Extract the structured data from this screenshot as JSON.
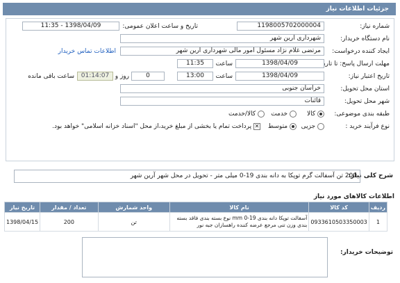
{
  "header": {
    "title": "جزئیات اطلاعات نیاز"
  },
  "fields": {
    "need_number_label": "شماره نیاز:",
    "need_number": "1198005702000004",
    "announce_label": "تاریخ و ساعت اعلان عمومی:",
    "announce_value": "1398/04/09 - 11:35",
    "buyer_org_label": "نام دستگاه خریدار:",
    "buyer_org": "شهرداری آرین شهر",
    "creator_label": "ایجاد کننده درخواست:",
    "creator": "مرتضی غلام نژاد مسئول امور مالی شهرداری آرین شهر",
    "contact_link": "اطلاعات تماس خریدار",
    "reply_deadline_label": "مهلت ارسال پاسخ: تا تاریخ:",
    "reply_date": "1398/04/09",
    "reply_time_label": "ساعت",
    "reply_time": "11:35",
    "validity_label": "تاریخ اعتبار نیاز:",
    "validity_date": "1398/04/09",
    "validity_time_label": "ساعت",
    "validity_time": "13:00",
    "days_value": "0",
    "days_label": "روز و",
    "remaining_value": "01:14:07",
    "remaining_label": "ساعت باقی مانده",
    "province_label": "استان محل تحویل:",
    "province": "خراسان جنوبی",
    "city_label": "شهر محل تحویل:",
    "city": "قائنات",
    "category_label": "طبقه بندی موضوعی:",
    "category_options": [
      "کالا",
      "خدمت",
      "کالا/خدمت"
    ],
    "process_label": "نوع فرآیند خرید :",
    "process_options": [
      "جزیی",
      "متوسط"
    ],
    "payment_note": "پرداخت تمام یا بخشی از مبلغ خرید،از محل \"اسناد خزانه اسلامی\" خواهد بود."
  },
  "description": {
    "label": "شرح کلی نیاز:",
    "value": "200 تن آسفالت گرم توپکا به دانه بندی 19-0 میلی متر - تحویل در محل شهر آرین شهر"
  },
  "items": {
    "title": "اطلاعات کالاهای مورد نیاز",
    "headers": [
      "ردیف",
      "کد کالا",
      "نام کالا",
      "واحد شمارش",
      "تعداد / مقدار",
      "تاریخ نیاز"
    ],
    "rows": [
      [
        "1",
        "0933610503350003",
        "آسفالت توپکا دانه بندی 19-0 mm نوع بسته بندی فاقد بسته بندی وزن تنی مرجع عرضه کننده راهسازان جبه نور",
        "تن",
        "200",
        "1398/04/15"
      ]
    ]
  },
  "buyer_notes": {
    "label": "توضیحات خریدار:",
    "value": ""
  }
}
